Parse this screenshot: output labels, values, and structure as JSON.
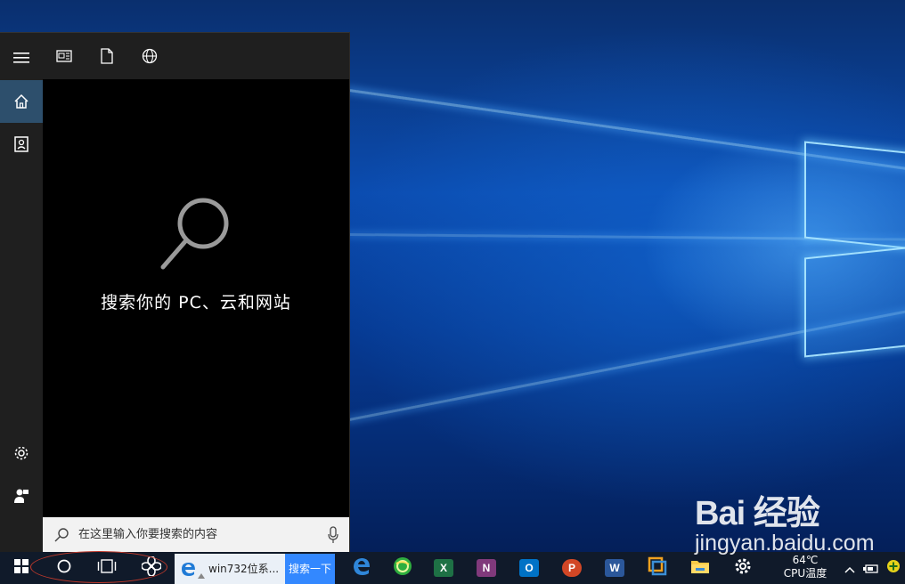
{
  "search_panel": {
    "prompt": "搜索你的 PC、云和网站",
    "input_placeholder": "在这里输入你要搜索的内容",
    "toolbar_icons": [
      "news-icon",
      "document-icon",
      "globe-icon"
    ],
    "rail_icons": [
      "hamburger-icon",
      "home-icon",
      "notebook-icon",
      "gear-icon",
      "feedback-icon"
    ]
  },
  "taskbar": {
    "browser_tab_title": "win732位系...",
    "browser_search_button": "搜索一下",
    "pinned_apps": [
      "edge",
      "360-browser",
      "excel",
      "onenote",
      "outlook",
      "powerpoint",
      "word",
      "vmware",
      "file-explorer",
      "settings"
    ],
    "app_letters": {
      "excel": "X",
      "onenote": "N",
      "outlook": "O",
      "powerpoint": "P",
      "word": "W"
    },
    "tray": {
      "temperature": "64℃",
      "temperature_label": "CPU温度"
    }
  },
  "watermark": {
    "logo": "Bai 经验",
    "url": "jingyan.baidu.com"
  },
  "colors": {
    "taskbar": "#101a2a",
    "panel_background": "#000000",
    "panel_rail": "#1f1f1f",
    "active_rail_item": "#2d4f6c",
    "search_button": "#3388ff",
    "annotation_circle": "#c0392b"
  }
}
